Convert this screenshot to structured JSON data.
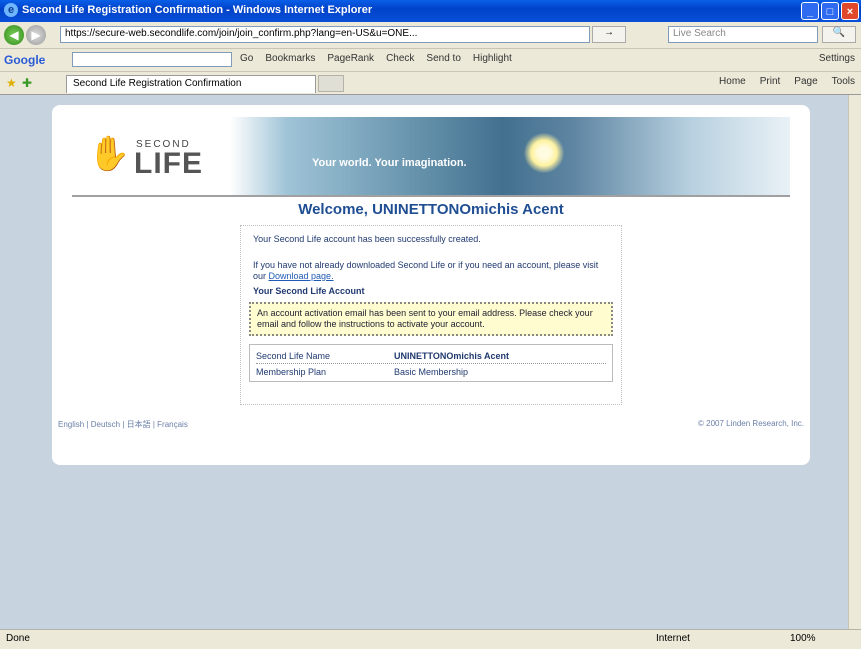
{
  "window": {
    "title": "Second Life Registration Confirmation - Windows Internet Explorer",
    "min": "_",
    "max": "□",
    "close": "×"
  },
  "addressbar": {
    "back": "◀",
    "forward": "▶",
    "url": "https://secure-web.secondlife.com/join/join_confirm.php?lang=en-US&u=ONE...",
    "go": "→",
    "search_placeholder": "Live Search",
    "search_go": "🔍"
  },
  "googlebar": {
    "logo": "Google",
    "items": [
      "Go",
      "Bookmarks",
      "PageRank",
      "Check",
      "Send to",
      "Highlight"
    ],
    "settings": "Settings"
  },
  "tabbar": {
    "tab_label": "Second Life Registration Confirmation",
    "tools": [
      "Home",
      "Print",
      "Page",
      "Tools"
    ]
  },
  "page": {
    "logo_second": "SECOND",
    "logo_life": "LIFE",
    "tagline": "Your world. Your imagination.",
    "welcome": "Welcome, UNINETTONOmichis Acent",
    "p1": "Your Second Life account has been successfully created.",
    "p2_text": "If you have not already downloaded Second Life or if you need an account, please visit our ",
    "p2_link": "Download page.",
    "header": "Your Second Life Account",
    "notice": "An account activation email has been sent to your email address. Please check your email and follow the instructions to activate your account.",
    "account_rows": [
      {
        "key": "Second Life Name",
        "value": "UNINETTONOmichis Acent"
      },
      {
        "key": "Membership Plan",
        "value": "Basic Membership"
      }
    ],
    "footer_left": "English | Deutsch | 日本語 | Français",
    "footer_right": "© 2007 Linden Research, Inc."
  },
  "status": {
    "left": "Done",
    "zone": "Internet",
    "zoom": "100%"
  }
}
